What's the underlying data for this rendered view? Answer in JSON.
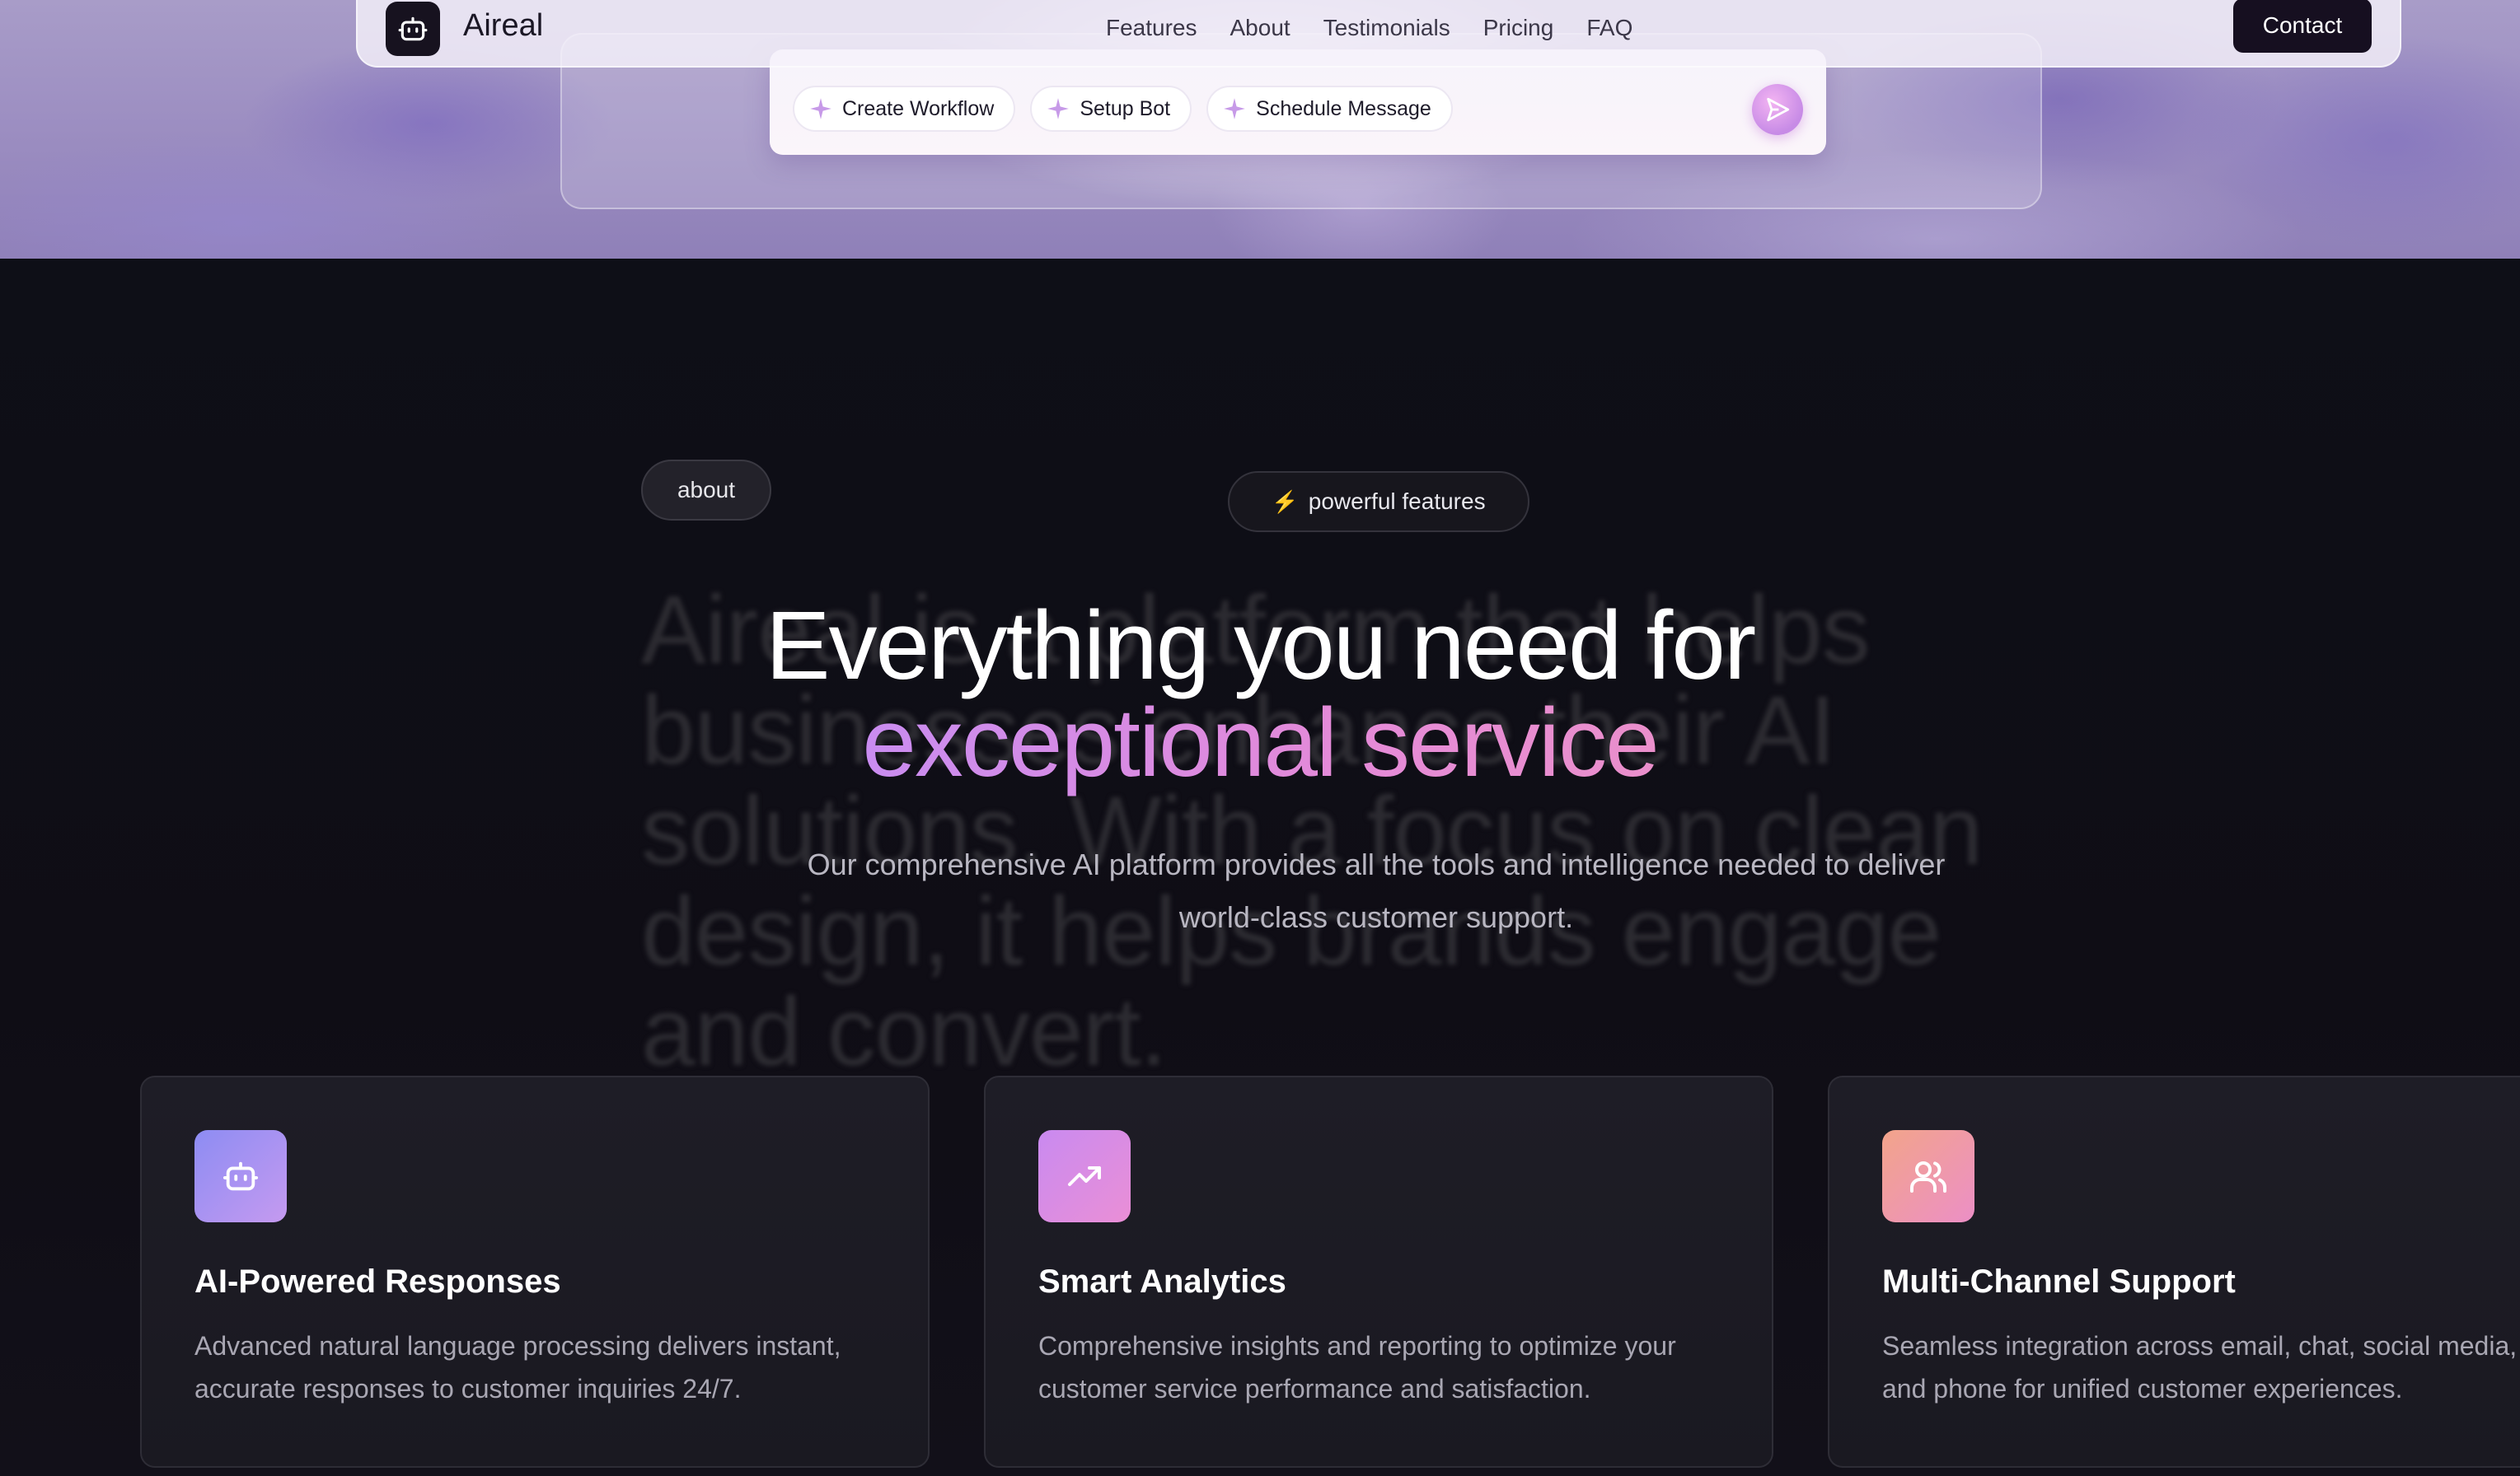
{
  "navbar": {
    "brand": "Aireal",
    "links": [
      "Features",
      "About",
      "Testimonials",
      "Pricing",
      "FAQ"
    ],
    "contact_label": "Contact",
    "logo_icon": "robot-icon"
  },
  "prompt_card": {
    "chips": [
      "Create Workflow",
      "Setup Bot",
      "Schedule Message"
    ],
    "chip_icon": "sparkle-icon",
    "send_icon": "send-icon"
  },
  "about": {
    "pill_label": "about",
    "background_text": "Aireal is a platform that helps businesses enhance their AI solutions. With a focus on clean design, it helps brands engage and convert."
  },
  "features": {
    "badge_label": "powerful features",
    "badge_icon": "lightning-icon",
    "headline_line1": "Everything you need for",
    "headline_line2": "exceptional service",
    "subtitle_line1": "Our comprehensive AI platform provides all the tools and intelligence needed to deliver",
    "subtitle_line2": "world-class customer support.",
    "cards": [
      {
        "icon": "robot-icon",
        "title": "AI-Powered Responses",
        "desc_line1": "Advanced natural language processing delivers instant,",
        "desc_line2": "accurate responses to customer inquiries 24/7."
      },
      {
        "icon": "trending-up-icon",
        "title": "Smart Analytics",
        "desc_line1": "Comprehensive insights and reporting to optimize your",
        "desc_line2": "customer service performance and satisfaction."
      },
      {
        "icon": "users-icon",
        "title": "Multi-Channel Support",
        "desc_line1": "Seamless integration across email, chat, social media,",
        "desc_line2": "and phone for unified customer experiences."
      }
    ]
  },
  "colors": {
    "accent_purple": "#c98cf0",
    "accent_pink": "#e48ad8",
    "dark_bg": "#0e0f17",
    "card_bg": "#1e1d26"
  }
}
